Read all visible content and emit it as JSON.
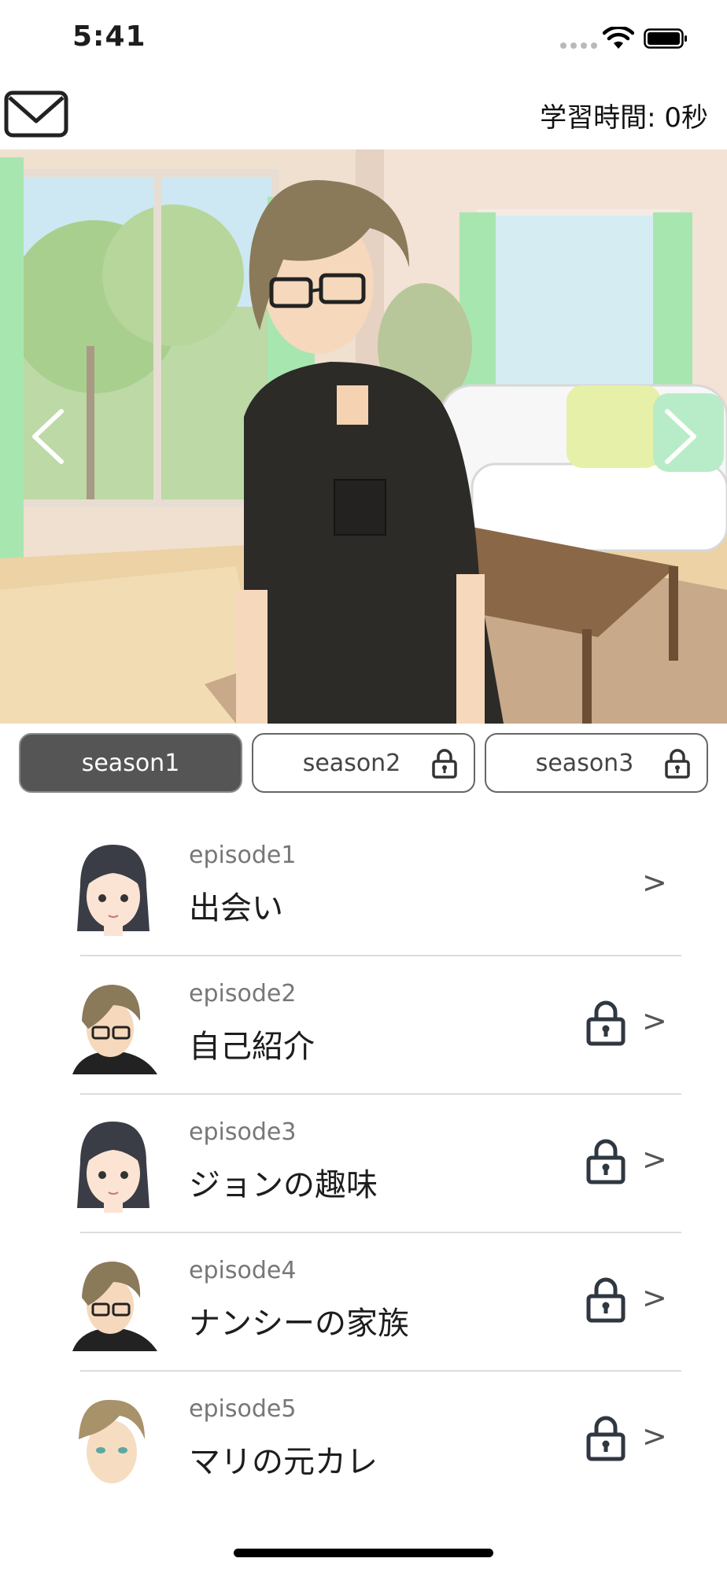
{
  "status_bar": {
    "time": "5:41"
  },
  "header": {
    "mail_icon": "mail-icon",
    "study_time": "学習時間: 0秒"
  },
  "banner": {
    "prev_icon": "chevron-left-icon",
    "next_icon": "chevron-right-icon"
  },
  "season_tabs": [
    {
      "label": "season1",
      "active": true,
      "locked": false
    },
    {
      "label": "season2",
      "active": false,
      "locked": true
    },
    {
      "label": "season3",
      "active": false,
      "locked": true
    }
  ],
  "episodes": [
    {
      "number": "episode1",
      "title": "出会い",
      "locked": false,
      "avatar": "dark-hair-girl-avatar",
      "chevron": ">"
    },
    {
      "number": "episode2",
      "title": "自己紹介",
      "locked": true,
      "avatar": "glasses-boy-avatar",
      "chevron": ">"
    },
    {
      "number": "episode3",
      "title": "ジョンの趣味",
      "locked": true,
      "avatar": "dark-hair-girl-avatar",
      "chevron": ">"
    },
    {
      "number": "episode4",
      "title": "ナンシーの家族",
      "locked": true,
      "avatar": "glasses-boy-avatar",
      "chevron": ">"
    },
    {
      "number": "episode5",
      "title": "マリの元カレ",
      "locked": true,
      "avatar": "blond-boy-avatar",
      "chevron": ">"
    }
  ],
  "colors": {
    "active_tab": "#555555",
    "tab_border": "#666666",
    "divider": "#dcdcdc",
    "secondary_text": "#777777"
  }
}
